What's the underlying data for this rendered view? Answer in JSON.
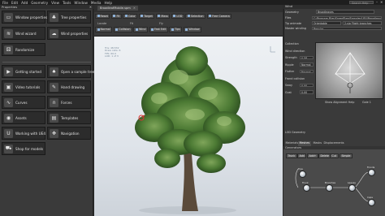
{
  "menu": [
    "File",
    "Edit",
    "Add",
    "Geometry",
    "View",
    "Tools",
    "Window",
    "Media",
    "Help"
  ],
  "search": {
    "placeholder": "Search Help"
  },
  "left": {
    "header": "Properties",
    "tiles_top": [
      {
        "label": "Window properties",
        "icon": "window-icon"
      },
      {
        "label": "Tree properties",
        "icon": "tree-icon"
      },
      {
        "label": "Wind wizard",
        "icon": "wind-icon"
      },
      {
        "label": "Wind properties",
        "icon": "wind-settings-icon"
      },
      {
        "label": "Randomize",
        "icon": "dice-icon"
      }
    ],
    "tiles_bottom": [
      {
        "label": "Getting started",
        "icon": "start-icon"
      },
      {
        "label": "Open a sample tree",
        "icon": "open-sample-icon"
      },
      {
        "label": "Video tutorials",
        "icon": "video-icon"
      },
      {
        "label": "Hand drawing",
        "icon": "pen-icon"
      },
      {
        "label": "Curves",
        "icon": "curves-icon"
      },
      {
        "label": "Forces",
        "icon": "magnet-icon"
      },
      {
        "label": "Assets",
        "icon": "assets-icon"
      },
      {
        "label": "Templates",
        "icon": "templates-icon"
      },
      {
        "label": "Working with UE4",
        "icon": "ue4-icon"
      },
      {
        "label": "Navigation",
        "icon": "navigation-icon"
      },
      {
        "label": "Shop for models",
        "icon": "cart-icon"
      }
    ]
  },
  "center": {
    "file_tab": "BroadleafMobile.spm",
    "toolbar_row1": [
      "Reset",
      "Fit",
      "Color",
      "Target",
      "Mass",
      "LOD",
      "Selection",
      "Free Camera"
    ],
    "group_labels": [
      "Locate",
      "Fit",
      "Fly"
    ],
    "toolbar_row2": [
      "Normal",
      "Collision",
      "Wind",
      "Fast Edit",
      "Tips",
      "Window"
    ],
    "info_lines": [
      "Tris: 48,532",
      "Draw calls: 6",
      "FPS: 60.0",
      "LOD: 1 of 3"
    ]
  },
  "right": {
    "header": "Wind",
    "geometry_label": "Geometry",
    "dropdown": "Broadleaves",
    "fields": [
      {
        "label": "Files",
        "value": "C:/Program Files/SpeedTree/Samples/UE4/Broadleaves.spm"
      },
      {
        "label": "Tip animate",
        "value": "Orientable",
        "extra": "2-sig Flight branches"
      },
      {
        "label": "Master winding",
        "value": "Regular"
      }
    ],
    "wind_fields": [
      {
        "label": "Collection",
        "value": ""
      },
      {
        "label": "Wind direction",
        "value": ""
      },
      {
        "label": "Strength",
        "value": "0.58"
      },
      {
        "label": "Ripple",
        "value": "Normal"
      },
      {
        "label": "Flutter",
        "value": "Normal"
      },
      {
        "label": "Frond collision",
        "value": ""
      },
      {
        "label": "Sway",
        "value": "0.00"
      },
      {
        "label": "Gust",
        "value": "0.00"
      }
    ],
    "sub_tabs": [
      "Show Alignment Help",
      "Gale 1"
    ],
    "lod_label": "LOD Geometry",
    "bottom_tabs": [
      "Materials",
      "Meshes",
      "Masks",
      "Displacements"
    ],
    "generators_label": "Generators",
    "gen_buttons": [
      "Trunk",
      "Add",
      "Add+",
      "Delete",
      "Cut",
      "Simple"
    ],
    "gen_nodes": [
      "Tree",
      "Trunk",
      "Branches",
      "Leaves",
      "Fronds",
      "Caps"
    ]
  },
  "colors": {
    "accent": "#8fb3d9",
    "panel": "#3a3a3a",
    "dark": "#1e1e1e"
  }
}
